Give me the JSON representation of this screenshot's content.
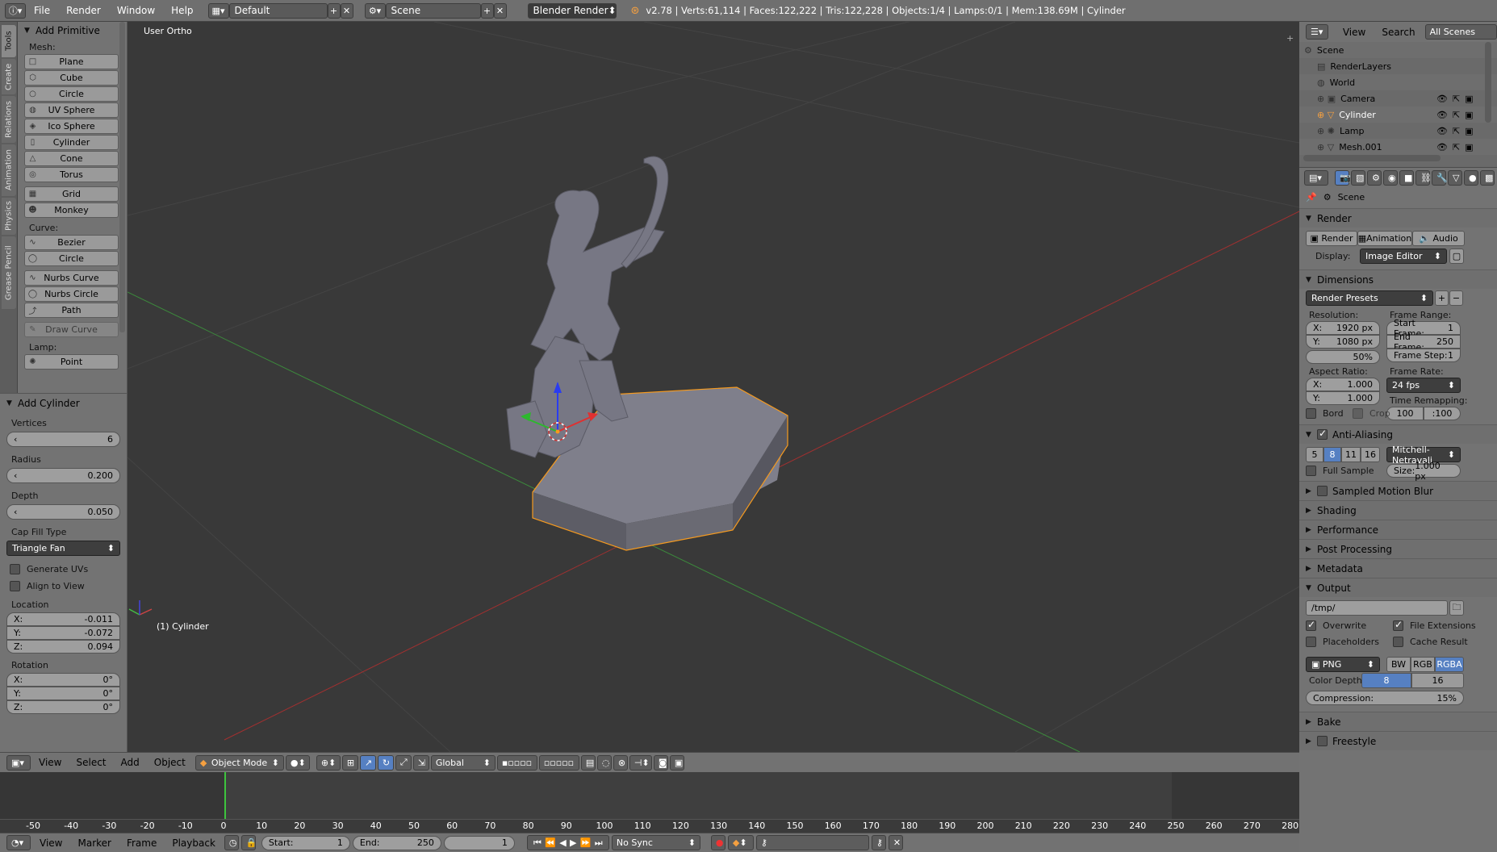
{
  "topbar": {
    "menus": [
      "File",
      "Render",
      "Window",
      "Help"
    ],
    "layout": "Default",
    "scene": "Scene",
    "engine": "Blender Render",
    "stats": "v2.78 | Verts:61,114 | Faces:122,222 | Tris:122,228 | Objects:1/4 | Lamps:0/1 | Mem:138.69M | Cylinder"
  },
  "tabs": [
    "Tools",
    "Create",
    "Relations",
    "Animation",
    "Physics",
    "Grease Pencil"
  ],
  "toolshelf": {
    "title": "Add Primitive",
    "mesh_label": "Mesh:",
    "mesh": [
      "Plane",
      "Cube",
      "Circle",
      "UV Sphere",
      "Ico Sphere",
      "Cylinder",
      "Cone",
      "Torus"
    ],
    "mesh2": [
      "Grid",
      "Monkey"
    ],
    "curve_label": "Curve:",
    "curve": [
      "Bezier",
      "Circle"
    ],
    "curve2": [
      "Nurbs Curve",
      "Nurbs Circle",
      "Path"
    ],
    "draw_curve": "Draw Curve",
    "lamp_label": "Lamp:",
    "lamp": [
      "Point"
    ]
  },
  "operator": {
    "title": "Add Cylinder",
    "vertices_label": "Vertices",
    "vertices": "6",
    "radius_label": "Radius",
    "radius": "0.200",
    "depth_label": "Depth",
    "depth": "0.050",
    "capfill_label": "Cap Fill Type",
    "capfill": "Triangle Fan",
    "gen_uvs": "Generate UVs",
    "align_view": "Align to View",
    "location_label": "Location",
    "loc_x": "-0.011",
    "loc_y": "-0.072",
    "loc_z": "0.094",
    "rotation_label": "Rotation",
    "rot_x": "0°",
    "rot_y": "0°",
    "rot_z": "0°",
    "x": "X:",
    "y": "Y:",
    "z": "Z:"
  },
  "viewport": {
    "view_label": "User Ortho",
    "object_label": "(1) Cylinder"
  },
  "vpheader": {
    "menus": [
      "View",
      "Select",
      "Add",
      "Object"
    ],
    "mode": "Object Mode",
    "orientation": "Global"
  },
  "timeline": {
    "ticks": [
      "-50",
      "-40",
      "-30",
      "-20",
      "-10",
      "0",
      "10",
      "20",
      "30",
      "40",
      "50",
      "60",
      "70",
      "80",
      "90",
      "100",
      "110",
      "120",
      "130",
      "140",
      "150",
      "160",
      "170",
      "180",
      "190",
      "200",
      "210",
      "220",
      "230",
      "240",
      "250",
      "260",
      "270",
      "280"
    ],
    "menus": [
      "View",
      "Marker",
      "Frame",
      "Playback"
    ],
    "start": "Start:",
    "start_val": "1",
    "end": "End:",
    "end_val": "250",
    "current": "1",
    "sync": "No Sync"
  },
  "outliner": {
    "menus": [
      "View",
      "Search"
    ],
    "filter": "All Scenes",
    "items": [
      "Scene",
      "RenderLayers",
      "World",
      "Camera",
      "Cylinder",
      "Lamp",
      "Mesh.001"
    ]
  },
  "props": {
    "scene": "Scene",
    "render": "Render",
    "render_btn": "Render",
    "anim_btn": "Animation",
    "audio_btn": "Audio",
    "display_lbl": "Display:",
    "display": "Image Editor",
    "dimensions": "Dimensions",
    "presets": "Render Presets",
    "resolution": "Resolution:",
    "res_x": "1920 px",
    "res_y": "1080 px",
    "res_pct": "50%",
    "frame_range": "Frame Range:",
    "start_frame": "Start Frame:",
    "start_frame_v": "1",
    "end_frame": "End Frame:",
    "end_frame_v": "250",
    "frame_step": "Frame Step:",
    "frame_step_v": "1",
    "aspect": "Aspect Ratio:",
    "asp_x": "1.000",
    "asp_y": "1.000",
    "frame_rate": "Frame Rate:",
    "fps": "24 fps",
    "time_remap": "Time Remapping:",
    "remap_old": "100",
    "remap_new": ":100",
    "bord": "Bord",
    "crop": "Crop",
    "aa": "Anti-Aliasing",
    "aa_levels": [
      "5",
      "8",
      "11",
      "16"
    ],
    "aa_filter": "Mitchell-Netravali",
    "full_sample": "Full Sample",
    "size": "Size:",
    "size_v": "1.000 px",
    "sampled_mb": "Sampled Motion Blur",
    "shading": "Shading",
    "performance": "Performance",
    "post": "Post Processing",
    "metadata": "Metadata",
    "output": "Output",
    "path": "/tmp/",
    "overwrite": "Overwrite",
    "file_ext": "File Extensions",
    "placeholders": "Placeholders",
    "cache": "Cache Result",
    "format": "PNG",
    "bw": "BW",
    "rgb": "RGB",
    "rgba": "RGBA",
    "color_depth": "Color Depth:",
    "depth8": "8",
    "depth16": "16",
    "compression": "Compression:",
    "compression_v": "15%",
    "bake": "Bake",
    "freestyle": "Freestyle"
  },
  "colors": {
    "selection": "#f59a1f",
    "axis_x": "#b33",
    "axis_y": "#4a4",
    "accent": "#5680c2"
  }
}
